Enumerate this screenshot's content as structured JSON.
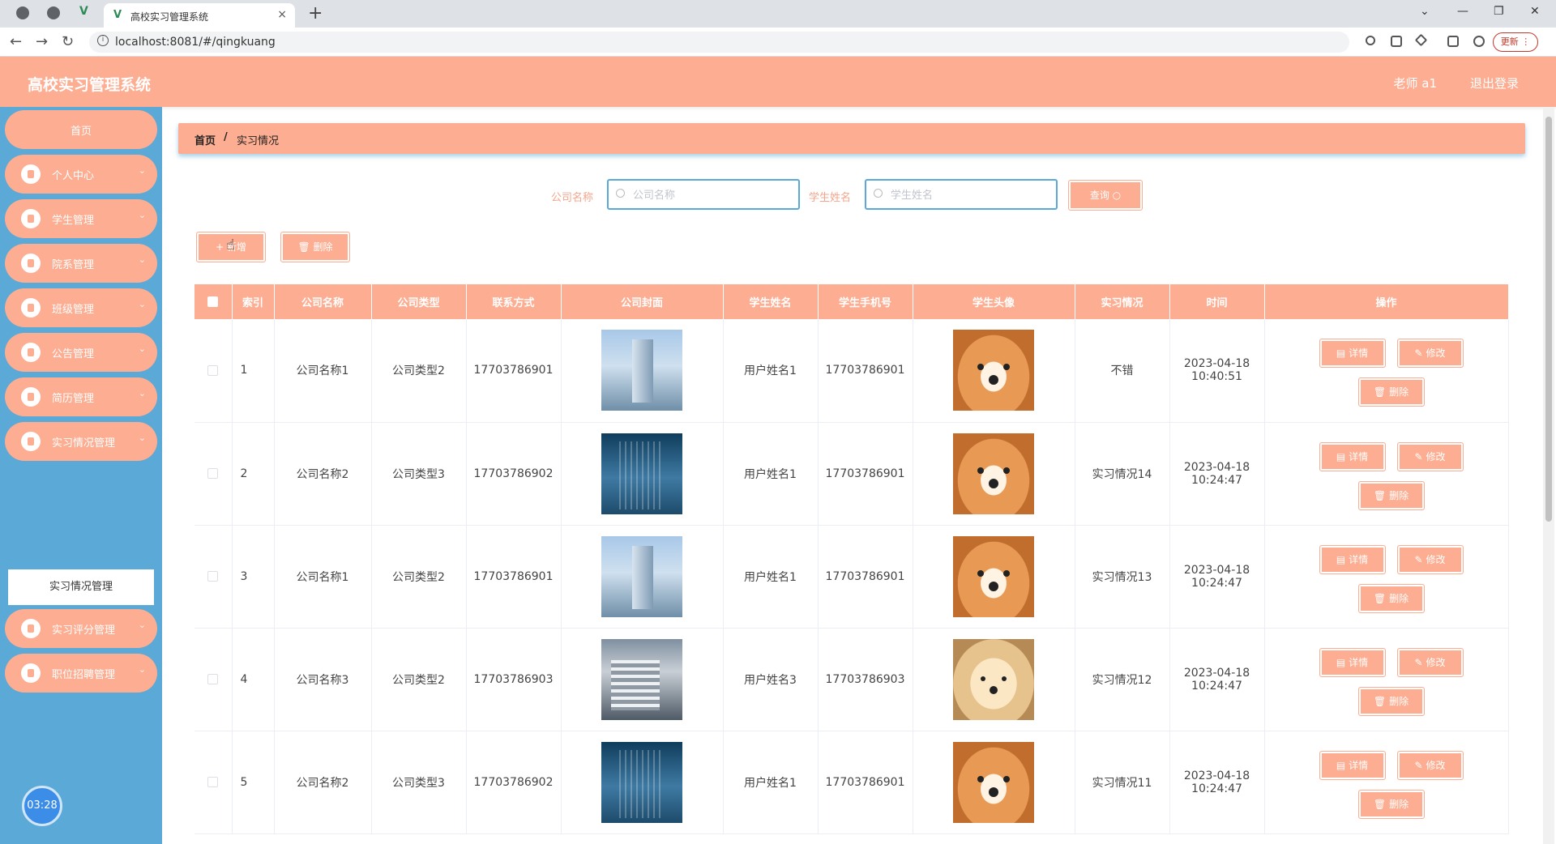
{
  "browser": {
    "tab_title": "高校实习管理系统",
    "close": "×",
    "new_tab": "+",
    "url": "localhost:8081/#/qingkuang",
    "update": "更新 ⋮",
    "back": "←",
    "forward": "→",
    "reload": "↻",
    "win_min": "—",
    "win_max": "❐",
    "win_close": "✕",
    "win_menu": "⌄"
  },
  "header": {
    "title": "高校实习管理系统",
    "user": "老师 a1",
    "logout": "退出登录"
  },
  "sidebar": {
    "home": "首页",
    "items": [
      {
        "label": "个人中心"
      },
      {
        "label": "学生管理"
      },
      {
        "label": "院系管理"
      },
      {
        "label": "班级管理"
      },
      {
        "label": "公告管理"
      },
      {
        "label": "简历管理"
      },
      {
        "label": "实习情况管理"
      },
      {
        "label": "实习评分管理"
      },
      {
        "label": "职位招聘管理"
      }
    ],
    "submenu": "实习情况管理",
    "chevron": "⌄"
  },
  "clock": "03:28",
  "breadcrumb": {
    "home": "首页",
    "sep": "/",
    "current": "实习情况"
  },
  "search": {
    "company_label": "公司名称",
    "company_placeholder": "公司名称",
    "student_label": "学生姓名",
    "student_placeholder": "学生姓名",
    "query": "查询 ○"
  },
  "actions": {
    "add": "+ 新增",
    "delete": "🗑 删除"
  },
  "table": {
    "columns": [
      "索引",
      "公司名称",
      "公司类型",
      "联系方式",
      "公司封面",
      "学生姓名",
      "学生手机号",
      "学生头像",
      "实习情况",
      "时间",
      "操作"
    ],
    "ops": {
      "detail": "详情",
      "edit": "修改",
      "remove": "删除"
    },
    "rows": [
      {
        "index": "1",
        "company": "公司名称1",
        "type": "公司类型2",
        "phone": "17703786901",
        "cover": "building-a",
        "student": "用户姓名1",
        "student_phone": "17703786901",
        "avatar": "shiba-dog",
        "status": "不错",
        "time": "2023-04-18 10:40:51"
      },
      {
        "index": "2",
        "company": "公司名称2",
        "type": "公司类型3",
        "phone": "17703786902",
        "cover": "building-b",
        "student": "用户姓名1",
        "student_phone": "17703786901",
        "avatar": "shiba-dog",
        "status": "实习情况14",
        "time": "2023-04-18 10:24:47"
      },
      {
        "index": "3",
        "company": "公司名称1",
        "type": "公司类型2",
        "phone": "17703786901",
        "cover": "building-a",
        "student": "用户姓名1",
        "student_phone": "17703786901",
        "avatar": "shiba-dog",
        "status": "实习情况13",
        "time": "2023-04-18 10:24:47"
      },
      {
        "index": "4",
        "company": "公司名称3",
        "type": "公司类型2",
        "phone": "17703786903",
        "cover": "building-c",
        "student": "用户姓名3",
        "student_phone": "17703786903",
        "avatar": "puppy-dog",
        "status": "实习情况12",
        "time": "2023-04-18 10:24:47"
      },
      {
        "index": "5",
        "company": "公司名称2",
        "type": "公司类型3",
        "phone": "17703786902",
        "cover": "building-b",
        "student": "用户姓名1",
        "student_phone": "17703786901",
        "avatar": "shiba-dog",
        "status": "实习情况11",
        "time": "2023-04-18 10:24:47"
      }
    ]
  },
  "colors": {
    "accent": "#fdad91",
    "sidebar": "#5aa9d7"
  }
}
